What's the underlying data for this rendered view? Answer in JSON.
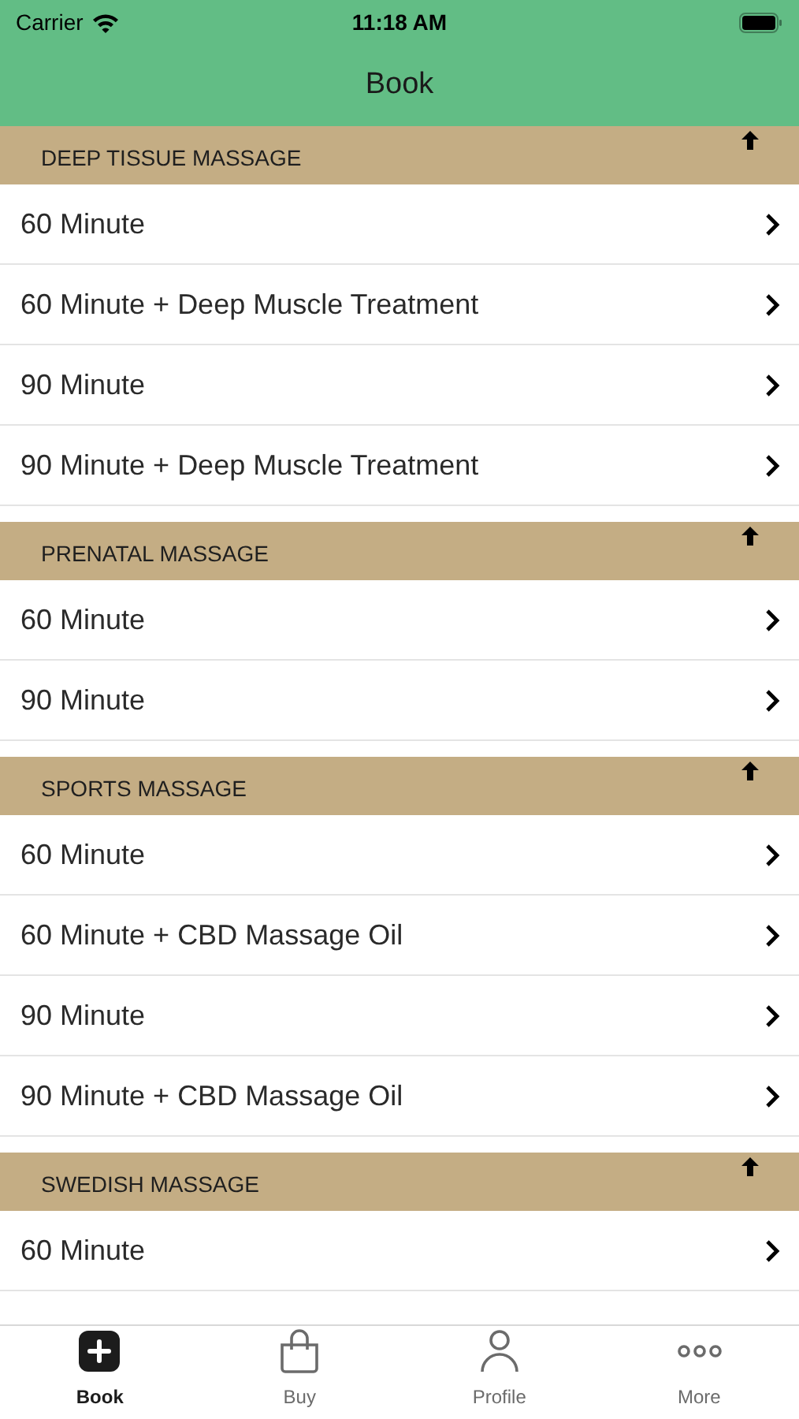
{
  "status_bar": {
    "carrier": "Carrier",
    "time": "11:18 AM"
  },
  "nav": {
    "title": "Book"
  },
  "sections": [
    {
      "title": "DEEP TISSUE MASSAGE",
      "items": [
        "60 Minute",
        "60 Minute + Deep Muscle Treatment",
        "90 Minute",
        "90 Minute + Deep Muscle Treatment"
      ]
    },
    {
      "title": "PRENATAL MASSAGE",
      "items": [
        "60 Minute",
        "90 Minute"
      ]
    },
    {
      "title": "SPORTS MASSAGE",
      "items": [
        "60 Minute",
        "60 Minute + CBD Massage Oil",
        "90 Minute",
        "90 Minute + CBD Massage Oil"
      ]
    },
    {
      "title": "SWEDISH MASSAGE",
      "items": [
        "60 Minute"
      ]
    }
  ],
  "tab_bar": [
    {
      "label": "Book",
      "kind": "book",
      "selected": true
    },
    {
      "label": "Buy",
      "kind": "buy",
      "selected": false
    },
    {
      "label": "Profile",
      "kind": "profile",
      "selected": false
    },
    {
      "label": "More",
      "kind": "more",
      "selected": false
    }
  ]
}
